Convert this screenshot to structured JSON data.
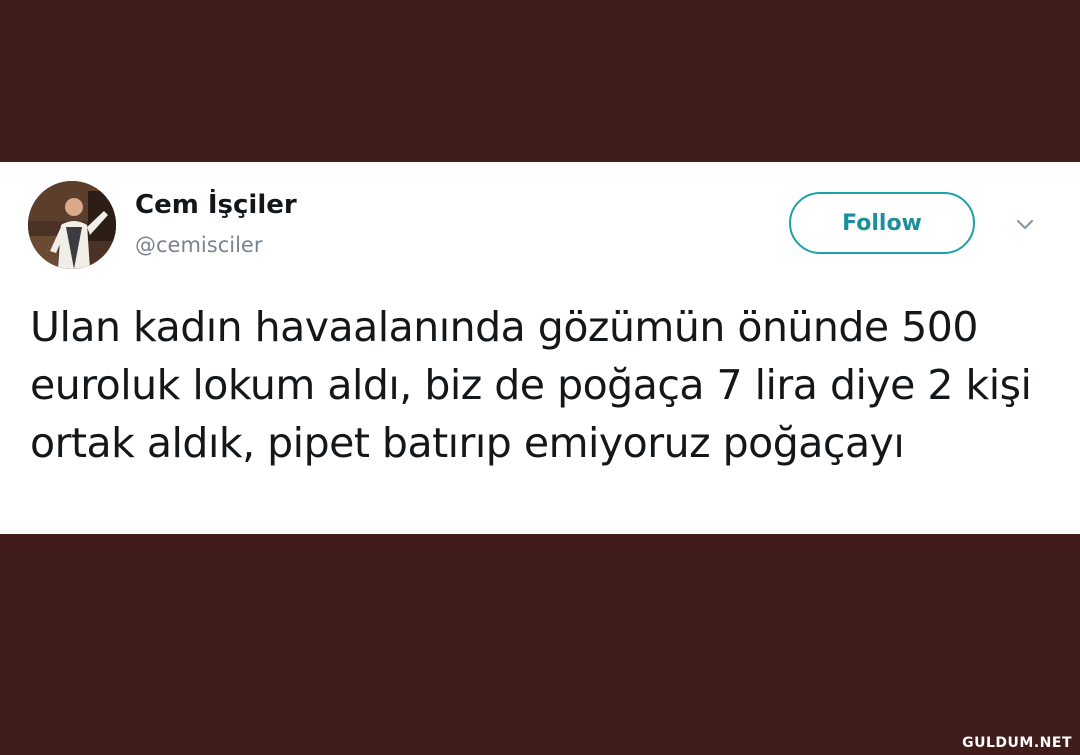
{
  "tweet": {
    "author": {
      "display_name": "Cem İşçiler",
      "handle": "@cemisciler"
    },
    "follow_label": "Follow",
    "text": "Ulan kadın havaalanında gözümün önünde 500 euroluk lokum aldı, biz de poğaça 7 lira diye 2 kişi ortak aldık, pipet batırıp emiyoruz poğaçayı"
  },
  "icons": {
    "avatar": "user-avatar-photo",
    "menu": "chevron-down-icon"
  },
  "colors": {
    "background": "#401c1a",
    "card": "#ffffff",
    "follow_border": "#1da1a8",
    "follow_text": "#1d8f9c",
    "handle_text": "#7a848c"
  },
  "watermark": "GULDUM.NET"
}
